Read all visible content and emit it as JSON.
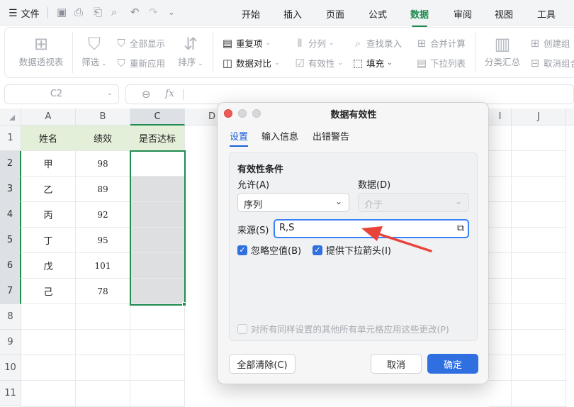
{
  "menubar": {
    "file_label": "文件",
    "tabs": [
      "开始",
      "插入",
      "页面",
      "公式",
      "数据",
      "审阅",
      "视图",
      "工具"
    ],
    "active_tab": "数据"
  },
  "ribbon": {
    "pivot": "数据透视表",
    "filter": "筛选",
    "show_all": "全部显示",
    "reapply": "重新应用",
    "sort": "排序",
    "duplicates": "重复项",
    "compare": "数据对比",
    "split": "分列",
    "validity": "有效性",
    "find_entry": "查找录入",
    "fill": "填充",
    "merge_calc": "合并计算",
    "dropdown_list": "下拉列表",
    "subtotal": "分类汇总",
    "create_group": "创建组",
    "ungroup": "取消组合"
  },
  "formula_bar": {
    "name_box": "C2",
    "fx_label": "fx",
    "formula": ""
  },
  "sheet": {
    "columns": [
      "A",
      "B",
      "C",
      "D",
      "I",
      "J"
    ],
    "rows": [
      "1",
      "2",
      "3",
      "4",
      "5",
      "6",
      "7",
      "8",
      "9",
      "10",
      "11"
    ],
    "header_row": [
      "姓名",
      "绩效",
      "是否达标"
    ],
    "data": [
      [
        "甲",
        "98"
      ],
      [
        "乙",
        "89"
      ],
      [
        "丙",
        "92"
      ],
      [
        "丁",
        "95"
      ],
      [
        "戊",
        "101"
      ],
      [
        "己",
        "78"
      ]
    ],
    "selected_cell": "C2"
  },
  "dialog": {
    "title": "数据有效性",
    "tabs": [
      "设置",
      "输入信息",
      "出错警告"
    ],
    "active_tab": "设置",
    "section_title": "有效性条件",
    "allow_label": "允许(A)",
    "allow_value": "序列",
    "data_label": "数据(D)",
    "data_value": "介于",
    "source_label": "来源(S)",
    "source_value": "R,S",
    "ignore_blank": "忽略空值(B)",
    "ignore_blank_checked": true,
    "dropdown_arrow": "提供下拉箭头(I)",
    "dropdown_arrow_checked": true,
    "apply_all": "对所有同样设置的其他所有单元格应用这些更改(P)",
    "apply_all_checked": false,
    "clear_all_button": "全部清除(C)",
    "cancel_button": "取消",
    "ok_button": "确定"
  },
  "colors": {
    "accent_green": "#1f8c4f",
    "header_fill": "#e4efd9",
    "primary_blue": "#2f6fe0",
    "annotation_red": "#e8443b"
  }
}
